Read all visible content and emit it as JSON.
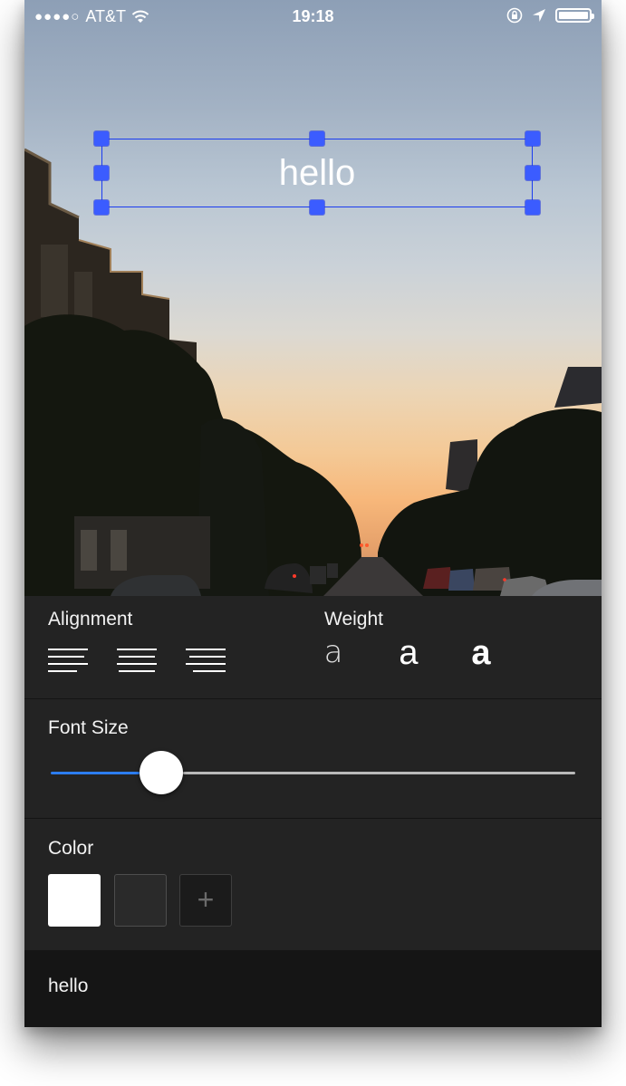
{
  "status_bar": {
    "signal_dots": "●●●●○",
    "carrier": "AT&T",
    "time": "19:18",
    "icons": [
      "wifi-icon",
      "orientation-lock-icon",
      "location-arrow-icon",
      "battery-icon"
    ]
  },
  "canvas": {
    "text": "hello",
    "text_color": "#ffffff",
    "selection_color": "#1a3cf0"
  },
  "alignment": {
    "label": "Alignment",
    "options": [
      "left",
      "center",
      "right"
    ]
  },
  "weight": {
    "label": "Weight",
    "light_glyph": "a",
    "regular_glyph": "a",
    "bold_glyph": "a"
  },
  "font_size": {
    "label": "Font Size",
    "value_fraction": 0.21,
    "accent": "#2c7df0"
  },
  "color": {
    "label": "Color",
    "swatches": [
      "#ffffff",
      "#2a2a2a"
    ],
    "add_glyph": "+"
  },
  "text_field": {
    "value": "hello"
  }
}
